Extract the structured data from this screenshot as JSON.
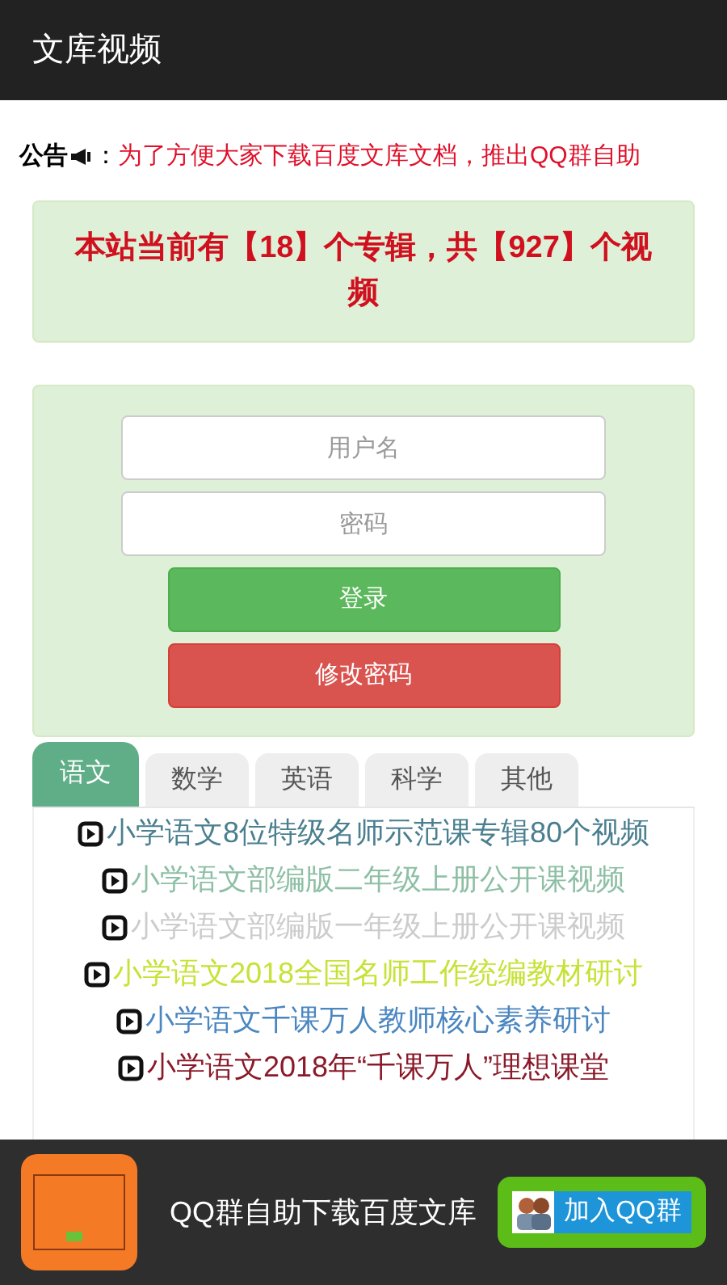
{
  "header": {
    "title": "文库视频"
  },
  "notice": {
    "label": "公告",
    "separator": "：",
    "text": "为了方便大家下载百度文库文档，推出QQ群自助"
  },
  "stats": {
    "text": "本站当前有【18】个专辑，共【927】个视频"
  },
  "login": {
    "username": {
      "placeholder": "用户名"
    },
    "password": {
      "placeholder": "密码"
    },
    "buttons": [
      {
        "label": "登录",
        "kind": "primary"
      },
      {
        "label": "修改密码",
        "kind": "danger"
      }
    ]
  },
  "tabs": [
    {
      "label": "语文",
      "selected": true
    },
    {
      "label": "数学",
      "selected": false
    },
    {
      "label": "英语",
      "selected": false
    },
    {
      "label": "科学",
      "selected": false
    },
    {
      "label": "其他",
      "selected": false
    }
  ],
  "videos": [
    {
      "title": "小学语文8位特级名师示范课专辑80个视频",
      "color": "#4a7f8f"
    },
    {
      "title": "小学语文部编版二年级上册公开课视频",
      "color": "#8ebfa5"
    },
    {
      "title": "小学语文部编版一年级上册公开课视频",
      "color": "#cccccc"
    },
    {
      "title": "小学语文2018全国名师工作统编教材研讨",
      "color": "#c6e236"
    },
    {
      "title": "小学语文千课万人教师核心素养研讨",
      "color": "#4a86c0"
    },
    {
      "title": "小学语文2018年“千课万人”理想课堂",
      "color": "#8a1a2a"
    }
  ],
  "banner": {
    "text": "QQ群自助下载百度文库",
    "button": "加入QQ群"
  }
}
